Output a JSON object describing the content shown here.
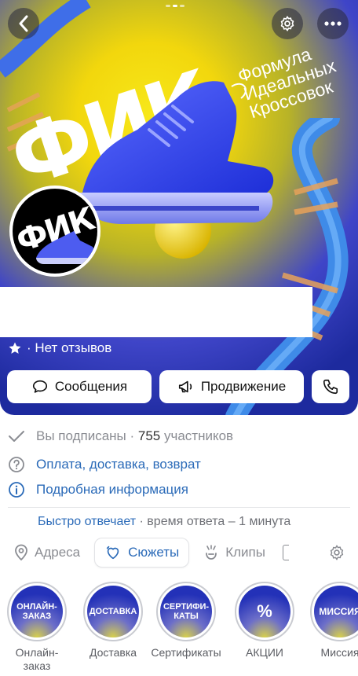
{
  "hero": {
    "logo_text": "ФИК",
    "tagline_lines": [
      "Формула",
      "Идеальных",
      "Кроссовок"
    ],
    "reviews_text": "· Нет отзывов"
  },
  "actions": {
    "messages": "Сообщения",
    "promotion": "Продвижение"
  },
  "info": {
    "subscribed": "Вы подписаны ·",
    "members_count": "755",
    "members_word": "участников",
    "payment": "Оплата, доставка, возврат",
    "details": "Подробная информация",
    "fast_reply": "Быстро отвечает",
    "reply_time": "· время ответа – 1 минута"
  },
  "tabs": {
    "addresses": "Адреса",
    "stories": "Сюжеты",
    "clips": "Клипы"
  },
  "stories": [
    {
      "bubble": "ОНЛАЙН-ЗАКАЗ",
      "caption": "Онлайн-заказ"
    },
    {
      "bubble": "ДОСТАВКА",
      "caption": "Доставка"
    },
    {
      "bubble": "СЕРТИФИ-КАТЫ",
      "caption": "Сертификаты"
    },
    {
      "bubble": "%",
      "caption": "АКЦИИ"
    },
    {
      "bubble": "МИССИЯ",
      "caption": "Миссия"
    }
  ],
  "colors": {
    "accent": "#2a6ab8",
    "muted": "#8a8c92",
    "hero_blue": "#2331b8",
    "hero_yellow": "#f2d70d"
  }
}
